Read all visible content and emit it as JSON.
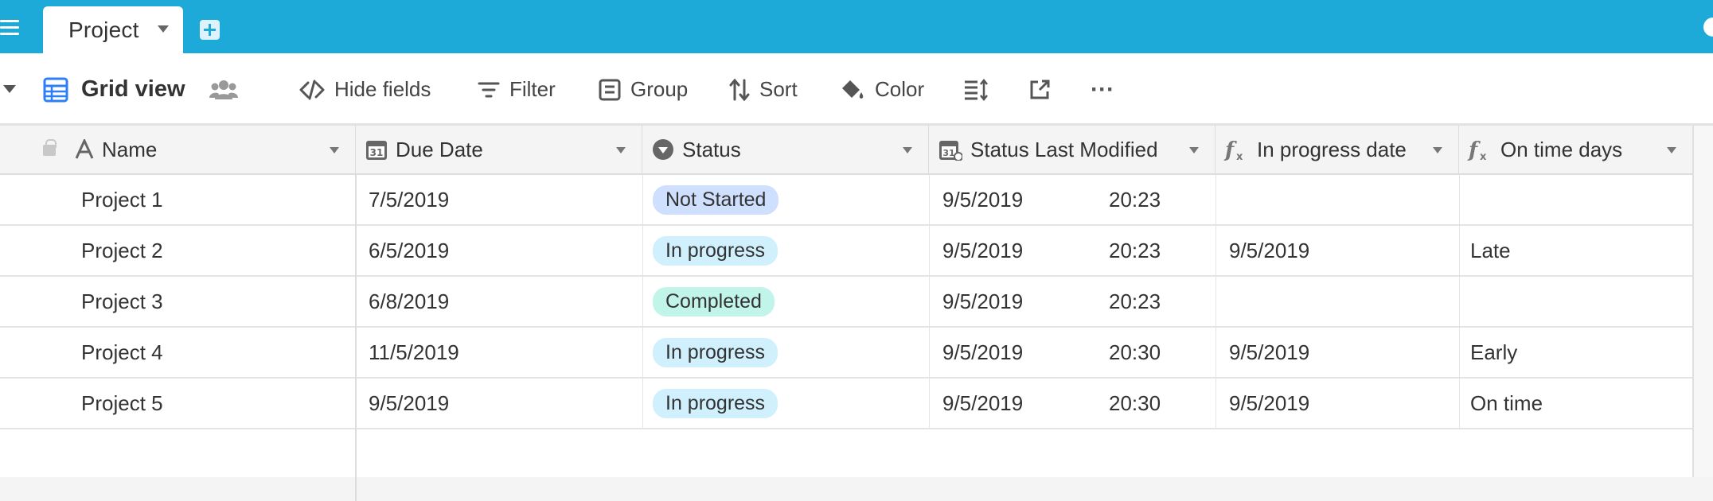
{
  "app": {
    "tab_label": "Project"
  },
  "toolbar": {
    "view_name": "Grid view",
    "hide_fields": "Hide fields",
    "filter": "Filter",
    "group": "Group",
    "sort": "Sort",
    "color": "Color",
    "more": "···"
  },
  "columns": [
    {
      "label": "Name",
      "icon": "text-a-icon"
    },
    {
      "label": "Due Date",
      "icon": "calendar-icon"
    },
    {
      "label": "Status",
      "icon": "single-select-icon"
    },
    {
      "label": "Status Last Modified",
      "icon": "calendar-modified-icon"
    },
    {
      "label": "In progress date",
      "icon": "formula-icon"
    },
    {
      "label": "On time days",
      "icon": "formula-icon"
    }
  ],
  "rows": [
    {
      "name": "Project 1",
      "due": "7/5/2019",
      "status": "Not Started",
      "modified_date": "9/5/2019",
      "modified_time": "20:23",
      "in_progress": "",
      "on_time": ""
    },
    {
      "name": "Project 2",
      "due": "6/5/2019",
      "status": "In progress",
      "modified_date": "9/5/2019",
      "modified_time": "20:23",
      "in_progress": "9/5/2019",
      "on_time": "Late"
    },
    {
      "name": "Project 3",
      "due": "6/8/2019",
      "status": "Completed",
      "modified_date": "9/5/2019",
      "modified_time": "20:23",
      "in_progress": "",
      "on_time": ""
    },
    {
      "name": "Project 4",
      "due": "11/5/2019",
      "status": "In progress",
      "modified_date": "9/5/2019",
      "modified_time": "20:30",
      "in_progress": "9/5/2019",
      "on_time": "Early"
    },
    {
      "name": "Project 5",
      "due": "9/5/2019",
      "status": "In progress",
      "modified_date": "9/5/2019",
      "modified_time": "20:30",
      "in_progress": "9/5/2019",
      "on_time": "On time"
    }
  ],
  "colors": {
    "topbar": "#1eaad9",
    "accent": "#2d7ff9",
    "pill_not_started": "#cfdffe",
    "pill_in_progress": "#d0f0fd",
    "pill_completed": "#c2f5e9"
  }
}
